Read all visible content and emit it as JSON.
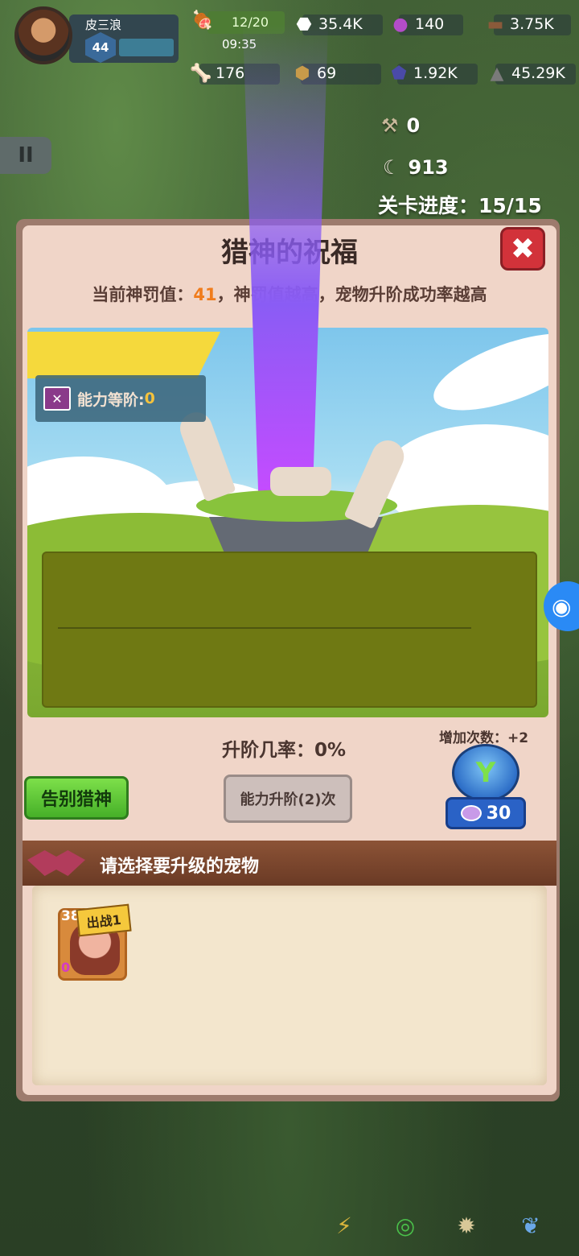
{
  "player": {
    "name": "皮三浪",
    "level": "44"
  },
  "energy": {
    "value": "12/20",
    "timer": "09:35",
    "icon": "meat-icon"
  },
  "resources_row1": [
    {
      "icon": "stone-icon",
      "value": "35.4K"
    },
    {
      "icon": "purple-orb-icon",
      "value": "140"
    },
    {
      "icon": "wood-icon",
      "value": "3.75K"
    }
  ],
  "resources_row2": [
    {
      "icon": "bone-icon",
      "value": "176"
    },
    {
      "icon": "fossil-icon",
      "value": "69"
    },
    {
      "icon": "crystal-icon",
      "value": "1.92K"
    },
    {
      "icon": "ore-icon",
      "value": "45.29K"
    }
  ],
  "side_stats": {
    "tools": "0",
    "claws": "913"
  },
  "stage_progress": "关卡进度：15/15",
  "dialog": {
    "title": "猎神的祝福",
    "subtitle_prefix": "当前神罚值：",
    "subtitle_value": "41",
    "subtitle_suffix": "，神罚值越高，宠物升阶成功率越高",
    "ability_label": "能力等阶:",
    "ability_value": "0",
    "upgrade_rate": "升阶几率：0%",
    "add_count": "增加次数：+2",
    "farewell_button": "告别猎神",
    "upgrade_button": "能力升阶(2)次",
    "cost": "30",
    "select_prompt": "请选择要升级的宠物"
  },
  "pets": [
    {
      "level": "38",
      "tag": "出战1",
      "stars": "0"
    }
  ],
  "colors": {
    "accent": "#f07c1c",
    "close": "#d2323a",
    "green_button": "#46b028"
  }
}
